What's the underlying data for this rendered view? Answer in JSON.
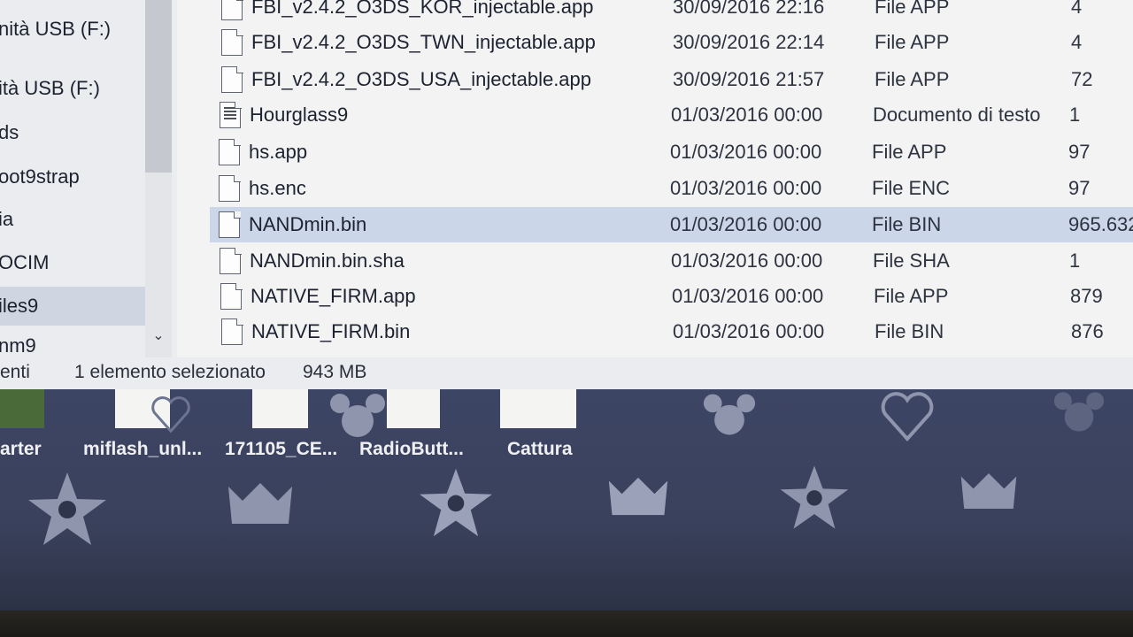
{
  "nav_pane": {
    "items": [
      {
        "label": "nità USB (F:)",
        "selected": false
      },
      {
        "label": "ità USB (F:)",
        "selected": false
      },
      {
        "label": "ds",
        "selected": false
      },
      {
        "label": "oot9strap",
        "selected": false
      },
      {
        "label": "ia",
        "selected": false
      },
      {
        "label": "OCIM",
        "selected": false
      },
      {
        "label": "iles9",
        "selected": true
      },
      {
        "label": "nm9",
        "selected": false
      }
    ],
    "scroll_down_glyph": "⌄"
  },
  "files": [
    {
      "name": "FBI_v2.4.2_O3DS_KOR_injectable.app",
      "date": "30/09/2016 22:16",
      "type": "File APP",
      "size": "4",
      "icon": "file-icon",
      "selected": false
    },
    {
      "name": "FBI_v2.4.2_O3DS_TWN_injectable.app",
      "date": "30/09/2016 22:14",
      "type": "File APP",
      "size": "4",
      "icon": "file-icon",
      "selected": false
    },
    {
      "name": "FBI_v2.4.2_O3DS_USA_injectable.app",
      "date": "30/09/2016 21:57",
      "type": "File APP",
      "size": "72",
      "icon": "file-icon",
      "selected": false
    },
    {
      "name": "Hourglass9",
      "date": "01/03/2016 00:00",
      "type": "Documento di testo",
      "size": "1",
      "icon": "text-file-icon",
      "selected": false
    },
    {
      "name": "hs.app",
      "date": "01/03/2016 00:00",
      "type": "File APP",
      "size": "97",
      "icon": "file-icon",
      "selected": false
    },
    {
      "name": "hs.enc",
      "date": "01/03/2016 00:00",
      "type": "File ENC",
      "size": "97",
      "icon": "file-icon",
      "selected": false
    },
    {
      "name": "NANDmin.bin",
      "date": "01/03/2016 00:00",
      "type": "File BIN",
      "size": "965.632",
      "icon": "file-icon",
      "selected": true
    },
    {
      "name": "NANDmin.bin.sha",
      "date": "01/03/2016 00:00",
      "type": "File SHA",
      "size": "1",
      "icon": "file-icon",
      "selected": false
    },
    {
      "name": "NATIVE_FIRM.app",
      "date": "01/03/2016 00:00",
      "type": "File APP",
      "size": "879",
      "icon": "file-icon",
      "selected": false
    },
    {
      "name": "NATIVE_FIRM.bin",
      "date": "01/03/2016 00:00",
      "type": "File BIN",
      "size": "876",
      "icon": "file-icon",
      "selected": false
    }
  ],
  "status_bar": {
    "count_fragment": "enti",
    "selection": "1 elemento selezionato",
    "size": "943 MB"
  },
  "desktop": {
    "icons": [
      {
        "label": "arter"
      },
      {
        "label": "miflash_unl..."
      },
      {
        "label": "171105_CE..."
      },
      {
        "label": "RadioButt..."
      },
      {
        "label": "Cattura"
      }
    ]
  },
  "colors": {
    "selection": "#cbd6e8",
    "desktop_bg": "#3d4565",
    "deco": "#8e95ad"
  }
}
